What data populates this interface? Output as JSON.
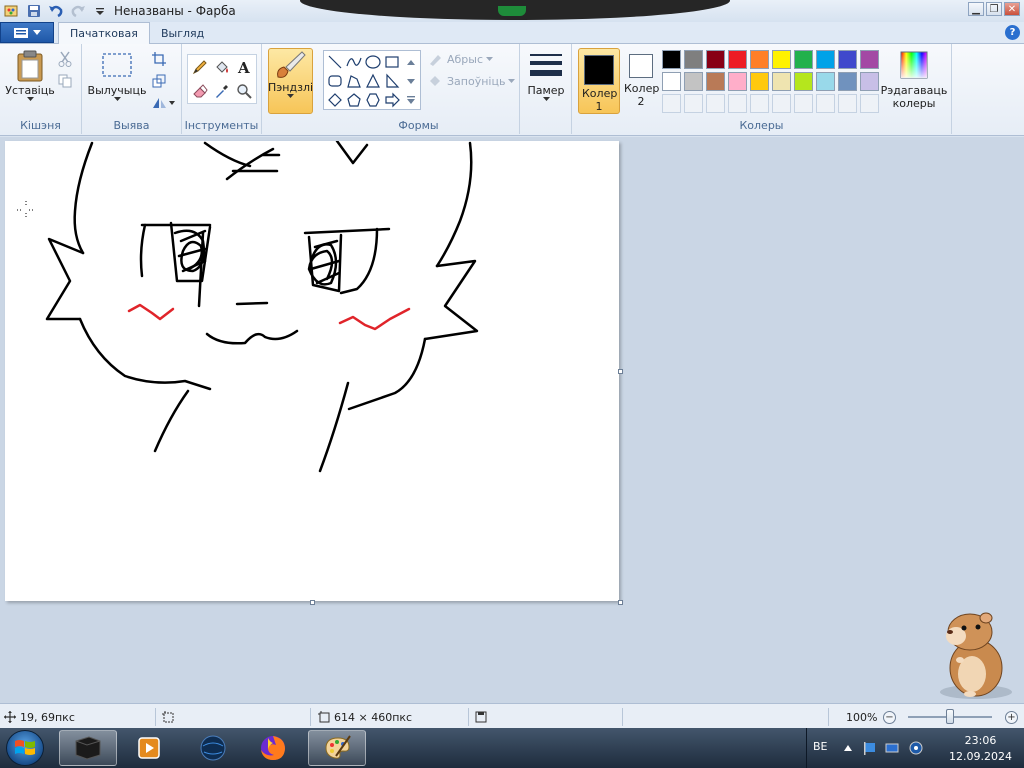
{
  "window": {
    "title": "Неназваны - Фарба"
  },
  "tabs": [
    {
      "label": "Пачатковая"
    },
    {
      "label": "Выгляд"
    }
  ],
  "ribbon": {
    "clipboard": {
      "paste_label": "Уставіць",
      "group_label": "Кішэня"
    },
    "image": {
      "select_label": "Вылучыць",
      "group_label": "Выява"
    },
    "tools": {
      "group_label": "Інструменты"
    },
    "brushes": {
      "label": "Пэндзлі"
    },
    "shapes": {
      "group_label": "Формы",
      "outline_label": "Абрыс",
      "fill_label": "Запоўніць"
    },
    "size": {
      "label": "Памер"
    },
    "colors": {
      "color1_label": "Колер 1",
      "color2_label": "Колер 2",
      "edit_label": "Рэдагаваць колеры",
      "group_label": "Колеры",
      "color1": "#000000",
      "color2": "#ffffff",
      "palette_row1": [
        "#000000",
        "#7f7f7f",
        "#880015",
        "#ed1c24",
        "#ff7f27",
        "#fff200",
        "#22b14c",
        "#00a2e8",
        "#3f48cc",
        "#a349a4"
      ],
      "palette_row2": [
        "#ffffff",
        "#c3c3c3",
        "#b97a57",
        "#ffaec9",
        "#ffc90e",
        "#efe4b0",
        "#b5e61d",
        "#99d9ea",
        "#7092be",
        "#c8bfe7"
      ]
    }
  },
  "statusbar": {
    "cursor_pos": "19, 69пкс",
    "canvas_size": "614 × 460пкс",
    "zoom": "100%"
  },
  "taskbar": {
    "language": "BE",
    "time": "23:06",
    "date": "12.09.2024"
  }
}
